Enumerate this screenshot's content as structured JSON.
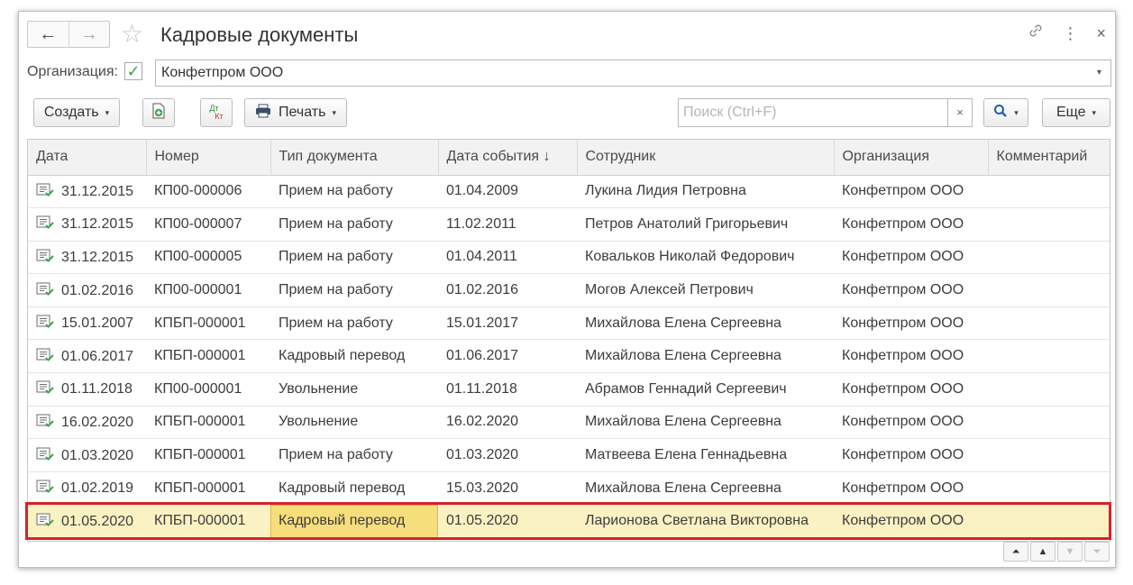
{
  "window": {
    "title": "Кадровые документы",
    "back_icon": "←",
    "forward_icon": "→",
    "star_icon": "☆",
    "link_icon": "🔗",
    "more_icon": "⋮",
    "close_icon": "×"
  },
  "organization": {
    "label": "Организация:",
    "checked_mark": "✓",
    "value": "Конфетпром ООО",
    "dropdown_icon": "▾"
  },
  "toolbar": {
    "create_label": "Создать",
    "print_label": "Печать",
    "dtkt_top": "Дт",
    "dtkt_bottom": "Кт",
    "search_placeholder": "Поиск (Ctrl+F)",
    "search_clear": "×",
    "more_label": "Еще",
    "caret": "▾"
  },
  "table": {
    "columns": [
      "Дата",
      "Номер",
      "Тип документа",
      "Дата события  ↓",
      "Сотрудник",
      "Организация",
      "Комментарий"
    ],
    "rows": [
      {
        "date": "31.12.2015",
        "number": "КП00-000006",
        "type": "Прием на работу",
        "event_date": "01.04.2009",
        "employee": "Лукина Лидия Петровна",
        "org": "Конфетпром ООО",
        "comment": ""
      },
      {
        "date": "31.12.2015",
        "number": "КП00-000007",
        "type": "Прием на работу",
        "event_date": "11.02.2011",
        "employee": "Петров Анатолий Григорьевич",
        "org": "Конфетпром ООО",
        "comment": ""
      },
      {
        "date": "31.12.2015",
        "number": "КП00-000005",
        "type": "Прием на работу",
        "event_date": "01.04.2011",
        "employee": "Ковальков Николай Федорович",
        "org": "Конфетпром ООО",
        "comment": ""
      },
      {
        "date": "01.02.2016",
        "number": "КП00-000001",
        "type": "Прием на работу",
        "event_date": "01.02.2016",
        "employee": "Могов Алексей Петрович",
        "org": "Конфетпром ООО",
        "comment": ""
      },
      {
        "date": "15.01.2007",
        "number": "КПБП-000001",
        "type": "Прием на работу",
        "event_date": "15.01.2017",
        "employee": "Михайлова Елена Сергеевна",
        "org": "Конфетпром ООО",
        "comment": ""
      },
      {
        "date": "01.06.2017",
        "number": "КПБП-000001",
        "type": "Кадровый перевод",
        "event_date": "01.06.2017",
        "employee": "Михайлова Елена Сергеевна",
        "org": "Конфетпром ООО",
        "comment": ""
      },
      {
        "date": "01.11.2018",
        "number": "КП00-000001",
        "type": "Увольнение",
        "event_date": "01.11.2018",
        "employee": "Абрамов Геннадий Сергеевич",
        "org": "Конфетпром ООО",
        "comment": ""
      },
      {
        "date": "16.02.2020",
        "number": "КПБП-000001",
        "type": "Увольнение",
        "event_date": "16.02.2020",
        "employee": "Михайлова Елена Сергеевна",
        "org": "Конфетпром ООО",
        "comment": ""
      },
      {
        "date": "01.03.2020",
        "number": "КПБП-000001",
        "type": "Прием на работу",
        "event_date": "01.03.2020",
        "employee": "Матвеева Елена Геннадьевна",
        "org": "Конфетпром ООО",
        "comment": ""
      },
      {
        "date": "01.02.2019",
        "number": "КПБП-000001",
        "type": "Кадровый перевод",
        "event_date": "15.03.2020",
        "employee": "Михайлова Елена Сергеевна",
        "org": "Конфетпром ООО",
        "comment": ""
      },
      {
        "date": "01.05.2020",
        "number": "КПБП-000001",
        "type": "Кадровый перевод",
        "event_date": "01.05.2020",
        "employee": "Ларионова Светлана Викторовна",
        "org": "Конфетпром ООО",
        "comment": "",
        "selected": true
      }
    ]
  },
  "pager": {
    "first": "⏶",
    "up": "▲",
    "down": "▼",
    "last": "⏷"
  },
  "colors": {
    "selected_row": "#fbf2c4",
    "active_cell": "#f7de7c",
    "highlight_frame": "#d9202c",
    "check_green": "#3aa34a"
  }
}
